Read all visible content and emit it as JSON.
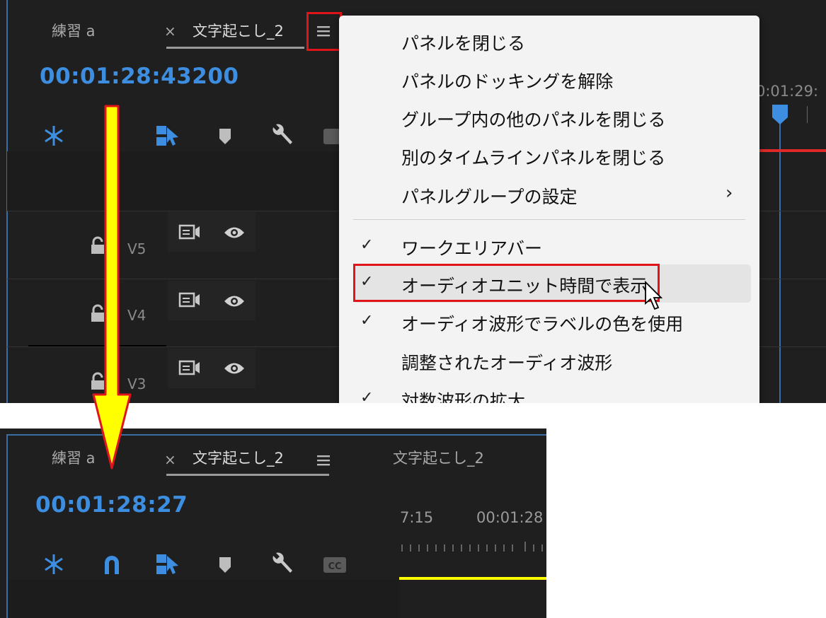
{
  "top": {
    "tabs": [
      {
        "label": "練習 a"
      },
      {
        "label": "文字起こし_2",
        "close": "×"
      }
    ],
    "timecode": "00:01:28:43200",
    "ruler_time": "0:01:29:",
    "tracks": [
      {
        "label": "V5"
      },
      {
        "label": "V4"
      },
      {
        "label": "V3"
      }
    ]
  },
  "menu": {
    "items": [
      {
        "label": "パネルを閉じる",
        "checked": false
      },
      {
        "label": "パネルのドッキングを解除",
        "checked": false
      },
      {
        "label": "グループ内の他のパネルを閉じる",
        "checked": false
      },
      {
        "label": "別のタイムラインパネルを閉じる",
        "checked": false
      },
      {
        "label": "パネルグループの設定",
        "checked": false,
        "submenu": "›"
      },
      {
        "label": "ワークエリアバー",
        "checked": true,
        "check": "✓"
      },
      {
        "label": "オーディオユニット時間で表示",
        "checked": true,
        "check": "✓",
        "highlighted": true
      },
      {
        "label": "オーディオ波形でラベルの色を使用",
        "checked": true,
        "check": "✓"
      },
      {
        "label": "調整されたオーディオ波形",
        "checked": false
      },
      {
        "label": "対数波形の拡大",
        "checked": true,
        "check": "✓"
      }
    ]
  },
  "bottom": {
    "tabs": [
      {
        "label": "練習 a"
      },
      {
        "label": "文字起こし_2",
        "close": "×"
      },
      {
        "label": "文字起こし_2"
      }
    ],
    "timecode": "00:01:28:27",
    "ruler_labels": [
      "7:15",
      "00:01:28"
    ]
  },
  "icons": [
    "snap-ripple-icon",
    "magnet-icon",
    "linked-selection-icon",
    "marker-icon",
    "wrench-icon",
    "captions-icon",
    "panel-menu-icon",
    "lock-icon",
    "camera-toggle-icon",
    "eye-icon",
    "cursor-icon"
  ],
  "colors": {
    "accent": "#3d8ee0",
    "highlight_box": "#e0141b",
    "arrow_fill": "#ffff00",
    "arrow_stroke": "#e0141b",
    "work_area": "#ffff00"
  }
}
